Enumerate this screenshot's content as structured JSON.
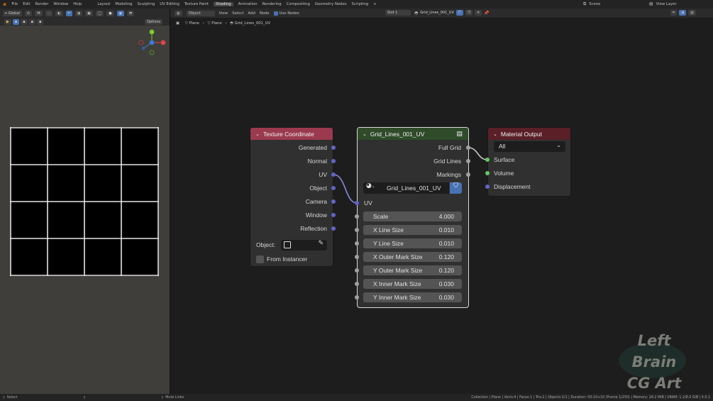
{
  "topbar": {
    "menus": [
      "File",
      "Edit",
      "Render",
      "Window",
      "Help"
    ],
    "workspaces": [
      {
        "label": "Layout",
        "active": false
      },
      {
        "label": "Modeling",
        "active": false
      },
      {
        "label": "Sculpting",
        "active": false
      },
      {
        "label": "UV Editing",
        "active": false
      },
      {
        "label": "Texture Paint",
        "active": false
      },
      {
        "label": "Shading",
        "active": true
      },
      {
        "label": "Animation",
        "active": false
      },
      {
        "label": "Rendering",
        "active": false
      },
      {
        "label": "Compositing",
        "active": false
      },
      {
        "label": "Geometry Nodes",
        "active": false
      },
      {
        "label": "Scripting",
        "active": false
      }
    ],
    "add_tab": "+",
    "scene": "Scene",
    "view_layer": "View Layer"
  },
  "viewport_header": {
    "transform_orientation": "Global",
    "options": "Options"
  },
  "node_editor_header": {
    "object_mode": "Object",
    "menus": [
      "View",
      "Select",
      "Add",
      "Node"
    ],
    "use_nodes": "Use Nodes",
    "slot": "Slot 1",
    "material": "Grid_Lines_001_UV"
  },
  "breadcrumb": {
    "object": "Plane",
    "mesh": "Plane",
    "material": "Grid_Lines_001_UV"
  },
  "nodes": {
    "texture_coordinate": {
      "title": "Texture Coordinate",
      "outputs": [
        "Generated",
        "Normal",
        "UV",
        "Object",
        "Camera",
        "Window",
        "Reflection"
      ],
      "object_label": "Object:",
      "from_instancer": "From Instancer"
    },
    "group": {
      "title": "Grid_Lines_001_UV",
      "outputs": [
        "Full Grid",
        "Grid Lines",
        "Markings"
      ],
      "datablock": "Grid_Lines_001_UV",
      "uv_input": "UV",
      "params": [
        {
          "label": "Scale",
          "value": "4.000"
        },
        {
          "label": "X Line Size",
          "value": "0.010"
        },
        {
          "label": "Y Line Size",
          "value": "0.010"
        },
        {
          "label": "X Outer Mark Size",
          "value": "0.120"
        },
        {
          "label": "Y Outer Mark Size",
          "value": "0.120"
        },
        {
          "label": "X Inner Mark Size",
          "value": "0.030"
        },
        {
          "label": "Y Inner Mark Size",
          "value": "0.030"
        }
      ]
    },
    "material_output": {
      "title": "Material Output",
      "target": "All",
      "inputs": [
        "Surface",
        "Volume",
        "Displacement"
      ]
    }
  },
  "status_bar": {
    "left": "Select",
    "middle": "Mute Links",
    "right": "Collection | Plane | Verts:4 | Faces:1 | Tris:2 | Objects:1/1 | Duration: 00:10+10 (Frame 1/250) | Memory: 28.2 MiB | VRAM: 1.2/8.0 GiB | 4.0.1"
  },
  "watermark": {
    "line1": "Left Brain",
    "line2": "CG Art"
  },
  "colors": {
    "tex_coord_header": "#9b3a4e",
    "group_header": "#2f4b2a",
    "output_header": "#5a1f27",
    "vector_socket": "#6363c7",
    "shader_socket": "#63c763",
    "float_socket": "#a1a1a1",
    "accent": "#4772b3"
  }
}
